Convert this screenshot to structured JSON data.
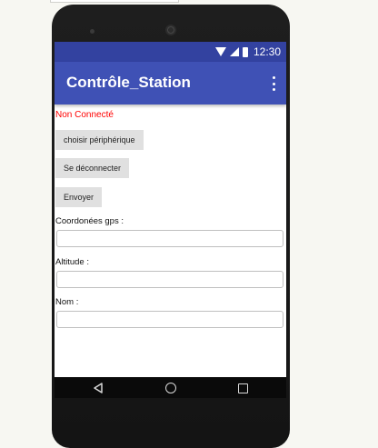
{
  "status_bar": {
    "time": "12:30",
    "icons": [
      "wifi-icon",
      "signal-icon",
      "battery-icon"
    ]
  },
  "app_bar": {
    "title": "Contrôle_Station",
    "menu_icon": "overflow-menu-icon"
  },
  "connection_status": {
    "text": "Non Connecté",
    "color": "#ff0000"
  },
  "buttons": {
    "choose_device": "choisir périphérique",
    "disconnect": "Se déconnecter",
    "send": "Envoyer"
  },
  "fields": {
    "gps": {
      "label": "Coordonées gps :",
      "value": ""
    },
    "altitude": {
      "label": "Altitude :",
      "value": ""
    },
    "name": {
      "label": "Nom :",
      "value": ""
    }
  },
  "nav_bar": {
    "icons": [
      "back-icon",
      "home-icon",
      "recents-icon"
    ]
  },
  "colors": {
    "status_bar": "#3342a0",
    "app_bar": "#3f51b5",
    "button": "#e0e0e0"
  }
}
